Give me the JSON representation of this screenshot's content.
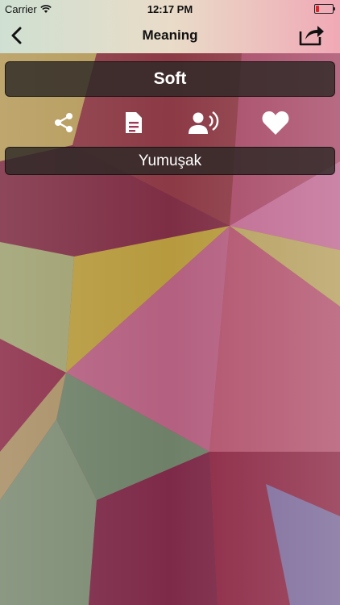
{
  "status_bar": {
    "carrier": "Carrier",
    "time": "12:17 PM",
    "battery_color": "#e0242b"
  },
  "nav": {
    "title": "Meaning",
    "back_icon": "chevron-left-icon",
    "share_out_icon": "share-out-icon"
  },
  "word": {
    "text": "Soft"
  },
  "actions": [
    {
      "name": "share",
      "icon": "share-icon"
    },
    {
      "name": "copy",
      "icon": "document-icon"
    },
    {
      "name": "speak",
      "icon": "speaker-person-icon"
    },
    {
      "name": "favorite",
      "icon": "heart-icon"
    }
  ],
  "meaning": {
    "text": "Yumuşak"
  },
  "colors": {
    "box_background": "#2d2826",
    "text": "#ffffff"
  }
}
